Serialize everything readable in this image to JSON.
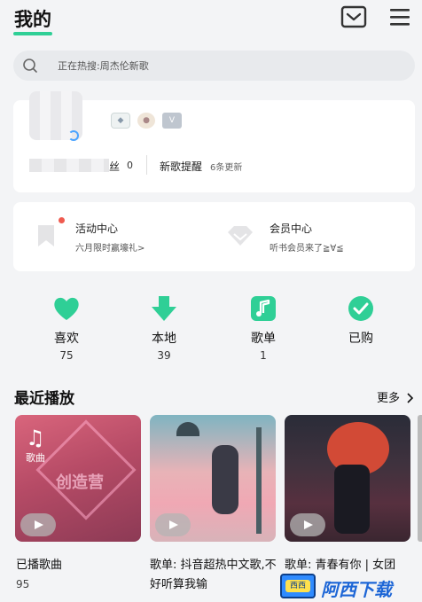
{
  "header": {
    "title": "我的"
  },
  "search": {
    "placeholder": "正在热搜:周杰伦新歌"
  },
  "profile": {
    "fans_label": "丝",
    "fans_count": "0",
    "new_songs_label": "新歌提醒",
    "new_songs_count": "6条更新",
    "badges": [
      "徽章1",
      "徽章2",
      "V"
    ]
  },
  "activity": {
    "title": "活动中心",
    "subtitle": "六月限时赢壕礼>"
  },
  "vip": {
    "title": "会员中心",
    "subtitle": "听书会员来了≧∀≦"
  },
  "quick_actions": [
    {
      "label": "喜欢",
      "count": "75",
      "icon": "heart-icon",
      "color": "#2fcf96"
    },
    {
      "label": "本地",
      "count": "39",
      "icon": "download-arrow-icon",
      "color": "#2fcf96"
    },
    {
      "label": "歌单",
      "count": "1",
      "icon": "music-note-icon",
      "color": "#2fcf96"
    },
    {
      "label": "已购",
      "count": "",
      "icon": "check-circle-icon",
      "color": "#2fcf96"
    }
  ],
  "recent": {
    "title": "最近播放",
    "more": "更多",
    "tiles": [
      {
        "caption": "歌曲",
        "title": "已播歌曲",
        "count": "95",
        "cover_text": "创造营"
      },
      {
        "caption": "",
        "title": "歌单: 抖音超热中文歌,不好听算我输",
        "count": ""
      },
      {
        "caption": "",
        "title": "歌单: 青春有你 | 女团",
        "count": ""
      }
    ]
  },
  "watermark": {
    "text": "阿西下载",
    "box_text": "西西"
  },
  "colors": {
    "accent": "#2fcf96",
    "notify_dot": "#ef5a4f"
  }
}
